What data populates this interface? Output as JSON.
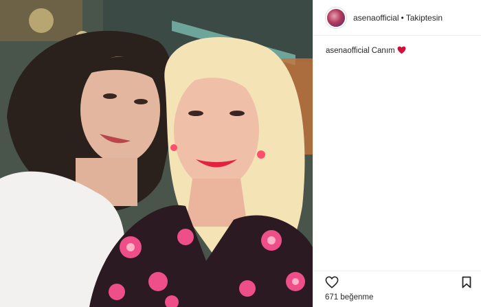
{
  "post": {
    "username": "asenaofficial",
    "separator": "•",
    "follow_status": "Takiptesin",
    "caption_user": "asenaofficial",
    "caption_text": "Canım",
    "caption_emoji": "red-heart-icon",
    "likes_text": "671 beğenme"
  },
  "icons": {
    "like": "heart-outline-icon",
    "save": "bookmark-icon"
  },
  "colors": {
    "text": "#262626",
    "divider": "#efefef",
    "heart_red": "#e0245e"
  }
}
